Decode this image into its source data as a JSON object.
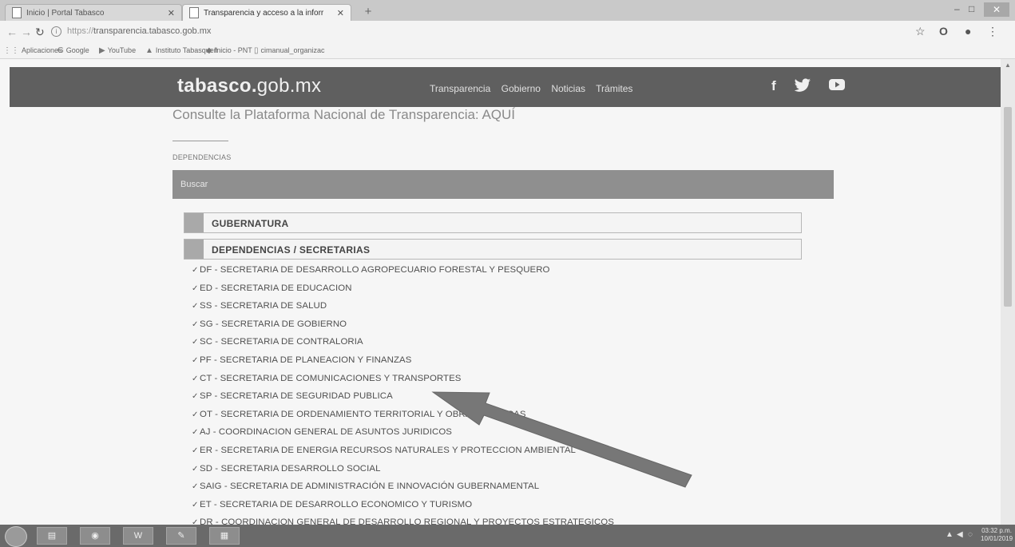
{
  "browser": {
    "tabs": [
      {
        "title": "Inicio | Portal Tabasco",
        "active": false
      },
      {
        "title": "Transparencia y acceso a la inforr",
        "active": true
      }
    ],
    "new_tab_label": "+",
    "window_controls": {
      "minimize": "–",
      "maximize": "□",
      "close": "✕"
    },
    "url_scheme": "https://",
    "url_host": "transparencia.tabasco.gob.mx",
    "bookmarks": [
      {
        "label": "Aplicaciones",
        "icon": "apps-icon"
      },
      {
        "label": "Google",
        "icon": "google-icon"
      },
      {
        "label": "YouTube",
        "icon": "youtube-icon"
      },
      {
        "label": "Instituto Tabasqueñ",
        "icon": "institute-icon"
      },
      {
        "label": "Inicio - PNT",
        "icon": "pnt-icon"
      },
      {
        "label": "cimanual_organizac",
        "icon": "page-icon"
      }
    ]
  },
  "site": {
    "logo_bold": "tabasco",
    "logo_dot": ".",
    "logo_light": "gob.mx",
    "nav": [
      "Transparencia",
      "Gobierno",
      "Noticias",
      "Trámites"
    ],
    "social": [
      "f",
      "twitter",
      "youtube"
    ],
    "partial_heading": "Consulte la Plataforma Nacional de Transparencia: AQUÍ",
    "section_label": "DEPENDENCIAS",
    "search_placeholder": "Buscar",
    "accordions": [
      {
        "label": "GUBERNATURA"
      },
      {
        "label": "DEPENDENCIAS / SECRETARIAS"
      }
    ],
    "dependencias": [
      "DF - SECRETARIA DE DESARROLLO AGROPECUARIO FORESTAL Y PESQUERO",
      "ED - SECRETARIA DE EDUCACION",
      "SS - SECRETARIA DE SALUD",
      "SG - SECRETARIA DE GOBIERNO",
      "SC - SECRETARIA DE CONTRALORIA",
      "PF - SECRETARIA DE PLANEACION Y FINANZAS",
      "CT - SECRETARIA DE COMUNICACIONES Y TRANSPORTES",
      "SP - SECRETARIA DE SEGURIDAD PUBLICA",
      "OT - SECRETARIA DE ORDENAMIENTO TERRITORIAL Y OBRAS PUBLICAS",
      "AJ - COORDINACION GENERAL DE ASUNTOS JURIDICOS",
      "ER - SECRETARIA DE ENERGIA RECURSOS NATURALES Y PROTECCION AMBIENTAL",
      "SD - SECRETARIA DESARROLLO SOCIAL",
      "SAIG - SECRETARIA DE ADMINISTRACIÓN E INNOVACIÓN GUBERNAMENTAL",
      "ET - SECRETARIA DE DESARROLLO ECONOMICO Y TURISMO",
      "DR - COORDINACION GENERAL DE DESARROLLO REGIONAL Y PROYECTOS ESTRATEGICOS"
    ]
  },
  "taskbar": {
    "items": [
      "folder",
      "chrome",
      "word",
      "paint",
      "photos"
    ],
    "word_label": "W",
    "clock_time": "03:32 p.m.",
    "clock_date": "10/01/2019"
  }
}
